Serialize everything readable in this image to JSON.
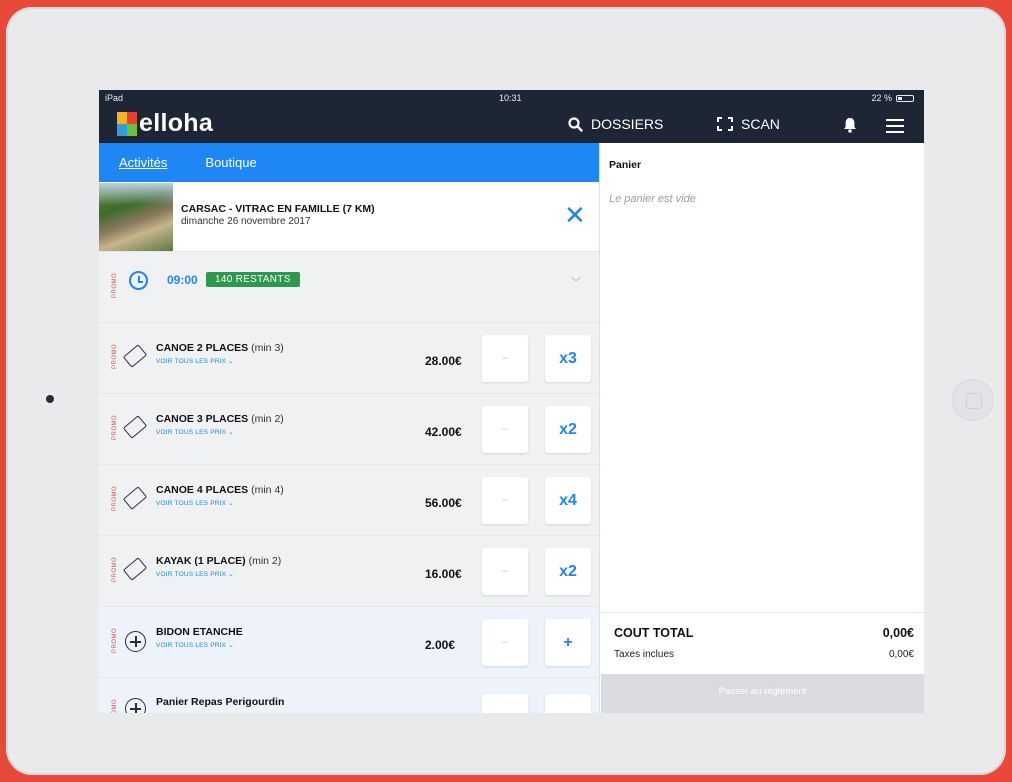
{
  "status_bar": {
    "left": "iPad",
    "time": "10:31",
    "battery": "22 %"
  },
  "header": {
    "logo_text": "elloha",
    "search_label": "DOSSIERS",
    "scan_label": "SCAN"
  },
  "tabs": [
    {
      "label": "Activités",
      "active": true
    },
    {
      "label": "Boutique",
      "active": false
    }
  ],
  "activity": {
    "title": "CARSAC - VITRAC EN FAMILLE (7 KM)",
    "date": "dimanche 26 novembre 2017"
  },
  "promo_label": "PROMO",
  "timeslot": {
    "time": "09:00",
    "remaining": "140 RESTANTS"
  },
  "products": [
    {
      "name": "CANOE 2 PLACES",
      "min": "(min 3)",
      "prices_link": "VOIR TOUS LES PRIX",
      "price": "28.00€",
      "minus": "–",
      "qty": "x3"
    },
    {
      "name": "CANOE 3 PLACES",
      "min": "(min 2)",
      "prices_link": "VOIR TOUS LES PRIX",
      "price": "42.00€",
      "minus": "–",
      "qty": "x2"
    },
    {
      "name": "CANOE 4 PLACES",
      "min": "(min 4)",
      "prices_link": "VOIR TOUS LES PRIX",
      "price": "56.00€",
      "minus": "–",
      "qty": "x4"
    },
    {
      "name": "KAYAK (1 PLACE)",
      "min": "(min 2)",
      "prices_link": "VOIR TOUS LES PRIX",
      "price": "16.00€",
      "minus": "–",
      "qty": "x2"
    },
    {
      "name": "BIDON ETANCHE",
      "min": "",
      "prices_link": "VOIR TOUS LES PRIX",
      "price": "2.00€",
      "minus": "–",
      "qty": "+"
    },
    {
      "name": "Panier Repas Perigourdin",
      "min": "",
      "prices_link": "",
      "price": "",
      "minus": "",
      "qty": ""
    }
  ],
  "cart": {
    "title": "Panier",
    "empty_text": "Le panier est vide",
    "total_label": "COUT TOTAL",
    "total_value": "0,00€",
    "tax_label": "Taxes inclues",
    "tax_value": "0,00€",
    "pay_button": "Passer au règlement"
  },
  "colors": {
    "background": "#e8493a",
    "topbar": "#1c2634",
    "accent": "#1e86f5",
    "badge_green": "#2b9a4a",
    "promo_red": "#e24a4a"
  }
}
